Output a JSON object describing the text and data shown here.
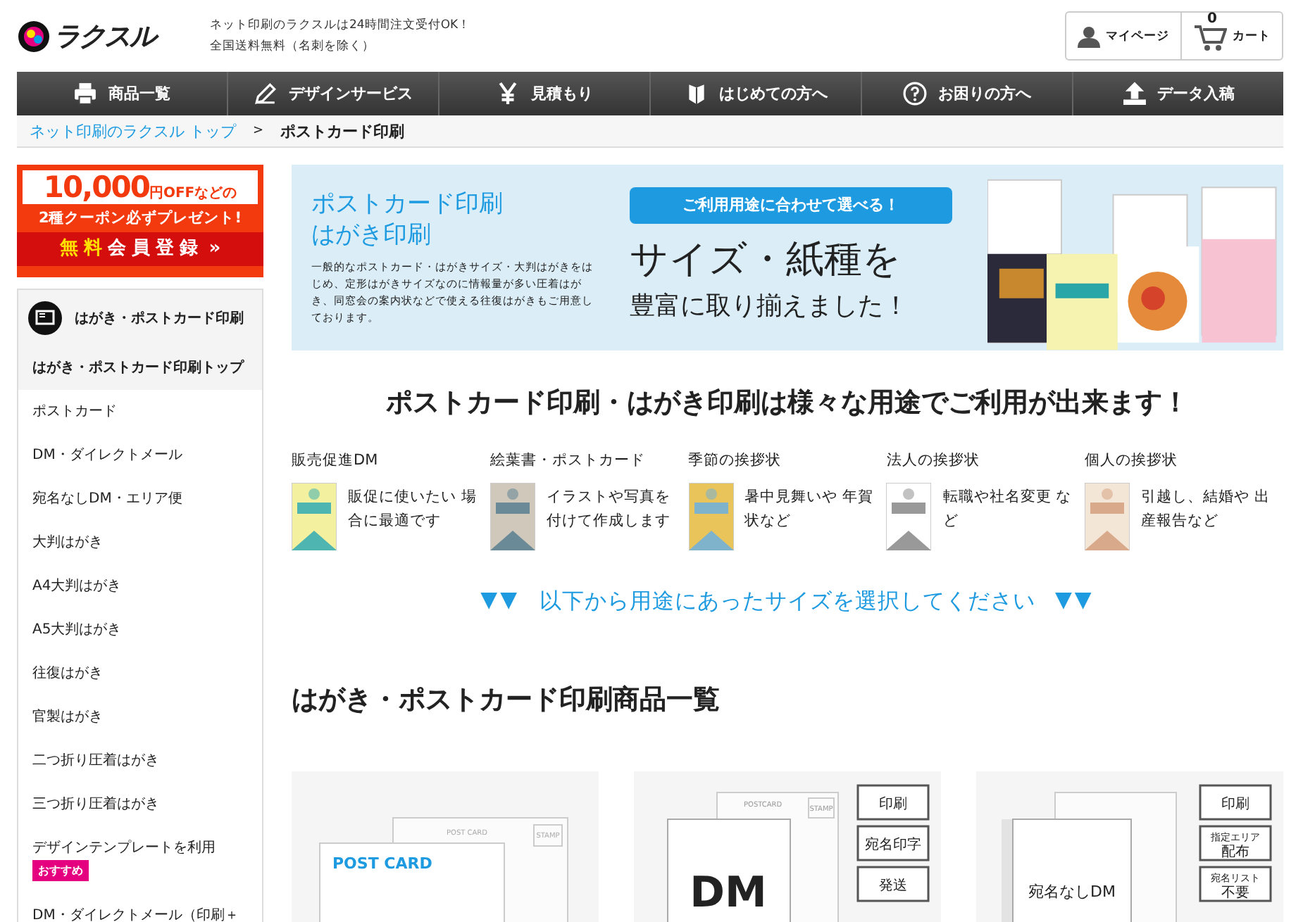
{
  "header": {
    "logo": "ラクスル",
    "tagline": [
      "ネット印刷のラクスルは24時間注文受付OK！",
      "全国送料無料（名刺を除く）"
    ],
    "mypage": "マイページ",
    "cart_count": "0",
    "cart": "カート"
  },
  "nav": [
    {
      "kind": "printer",
      "label": "商品一覧"
    },
    {
      "kind": "pencil",
      "label": "デザインサービス"
    },
    {
      "kind": "yen",
      "label": "見積もり"
    },
    {
      "kind": "leaf",
      "label": "はじめての方へ"
    },
    {
      "kind": "help",
      "label": "お困りの方へ"
    },
    {
      "kind": "upload",
      "label": "データ入稿"
    }
  ],
  "breadcrumb": {
    "items": [
      {
        "label": "ネット印刷のラクスル トップ",
        "link": true
      },
      {
        "label": "ポストカード印刷",
        "link": false
      }
    ],
    "separator": ">"
  },
  "promo": {
    "amount": "10,000",
    "unit": "円OFFなどの",
    "line2": "2種クーポン必ずプレゼント!",
    "cta_highlight": "無料",
    "cta": "会員登録",
    "cta_arrow": "»"
  },
  "sidebar": {
    "title": "はがき・ポストカード印刷",
    "items": [
      {
        "label": "はがき・ポストカード印刷トップ",
        "selected": true
      },
      {
        "label": "ポストカード",
        "selected": false
      },
      {
        "label": "DM・ダイレクトメール",
        "selected": false
      },
      {
        "label": "宛名なしDM・エリア便",
        "selected": false
      },
      {
        "label": "大判はがき",
        "selected": false
      },
      {
        "label": "A4大判はがき",
        "selected": false
      },
      {
        "label": "A5大判はがき",
        "selected": false
      },
      {
        "label": "往復はがき",
        "selected": false
      },
      {
        "label": "官製はがき",
        "selected": false
      },
      {
        "label": "二つ折り圧着はがき",
        "selected": false
      },
      {
        "label": "三つ折り圧着はがき",
        "selected": false
      },
      {
        "label": "デザインテンプレートを利用",
        "selected": false,
        "badge": "おすすめ"
      },
      {
        "label": "DM・ダイレクトメール（印刷＋",
        "selected": false
      }
    ]
  },
  "hero": {
    "title_lines": [
      "ポストカード印刷",
      "はがき印刷"
    ],
    "description": "一般的なポストカード・はがきサイズ・大判はがきをはじめ、定形はがきサイズなのに情報量が多い圧着はがき、同窓会の案内状などで使える往復はがきもご用意しております。",
    "pill": "ご利用用途に合わせて選べる！",
    "headline": "サイズ・紙種を",
    "subline": "豊富に取り揃えました！"
  },
  "uses_heading": "ポストカード印刷・はがき印刷は様々な用途でご利用が出来ます！",
  "uses": [
    {
      "title": "販売促進DM",
      "text": "販促に使いたい 場合に最適です"
    },
    {
      "title": "絵葉書・ポストカード",
      "text": "イラストや写真を付けて作成します"
    },
    {
      "title": "季節の挨拶状",
      "text": "暑中見舞いや 年賀状など"
    },
    {
      "title": "法人の挨拶状",
      "text": "転職や社名変更 など"
    },
    {
      "title": "個人の挨拶状",
      "text": "引越し、結婚や 出産報告など"
    }
  ],
  "select_prompt": {
    "arrows_left": "▼▼",
    "text": "以下から用途にあったサイズを選択してください",
    "arrows_right": "▼▼"
  },
  "products_heading": "はがき・ポストカード印刷商品一覧",
  "products": [
    {
      "kind": "postcard",
      "back_label": "POST CARD",
      "stamp": "STAMP",
      "front_label": "POST CARD"
    },
    {
      "kind": "dm",
      "back_label": "POSTCARD",
      "stamp": "STAMP",
      "front_label": "DM",
      "tags": [
        [
          "印刷"
        ],
        [
          "宛名印字"
        ],
        [
          "発送"
        ]
      ]
    },
    {
      "kind": "area",
      "front_label": "宛名なしDM",
      "tags": [
        [
          "印刷"
        ],
        [
          "指定エリア",
          "配布"
        ],
        [
          "宛名リスト",
          "不要"
        ]
      ]
    }
  ]
}
